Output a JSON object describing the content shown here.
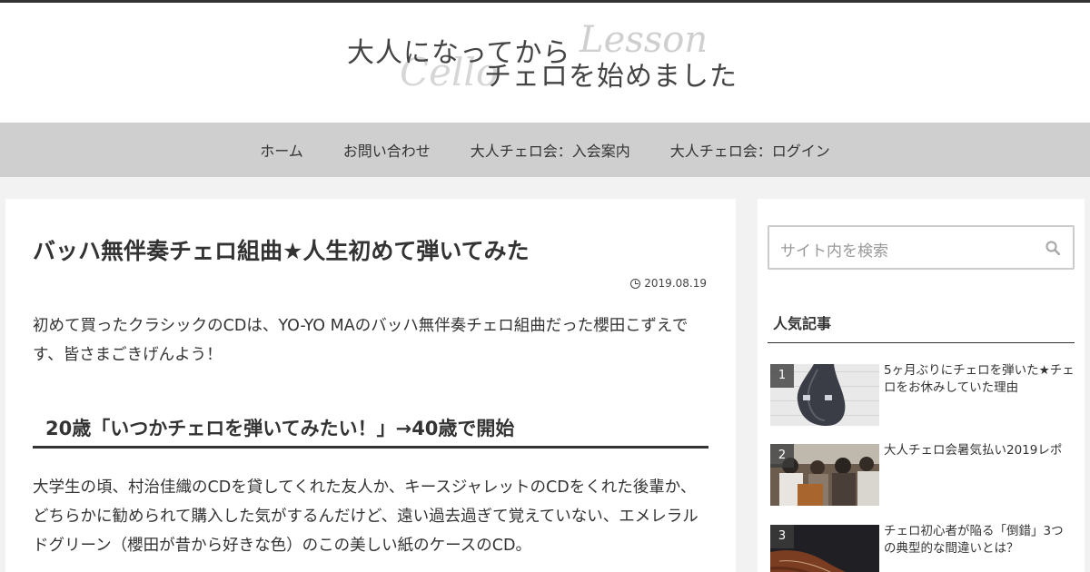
{
  "site": {
    "logo_line1": "大人になってから",
    "logo_line2": "チェロを始めました",
    "logo_deco1": "Lesson",
    "logo_deco2": "Cello"
  },
  "nav": {
    "items": [
      "ホーム",
      "お問い合わせ",
      "大人チェロ会：入会案内",
      "大人チェロ会：ログイン"
    ]
  },
  "article": {
    "title": "バッハ無伴奏チェロ組曲★人生初めて弾いてみた",
    "date": "2019.08.19",
    "para1": "初めて買ったクラシックのCDは、YO-YO MAのバッハ無伴奏チェロ組曲だった櫻田こずえです、皆さまごきげんよう！",
    "heading": "20歳「いつかチェロを弾いてみたい！」→40歳で開始",
    "para2": "大学生の頃、村治佳織のCDを貸してくれた友人か、キースジャレットのCDをくれた後輩か、どちらかに勧められて購入した気がするんだけど、遠い過去過ぎて覚えていない、エメレラルドグリーン（櫻田が昔から好きな色）のこの美しい紙のケースのCD。"
  },
  "sidebar": {
    "search_placeholder": "サイト内を検索",
    "popular_heading": "人気記事",
    "popular": [
      {
        "rank": "1",
        "title": "5ヶ月ぶりにチェロを弾いた★チェロをお休みしていた理由"
      },
      {
        "rank": "2",
        "title": "大人チェロ会暑気払い2019レポ"
      },
      {
        "rank": "3",
        "title": "チェロ初心者が陥る「倒錯」3つの典型的な間違いとは？"
      }
    ]
  },
  "colors": {
    "topbar": "#333333",
    "nav_bg": "#cfcfcf",
    "page_bg": "#f2f2f2"
  }
}
